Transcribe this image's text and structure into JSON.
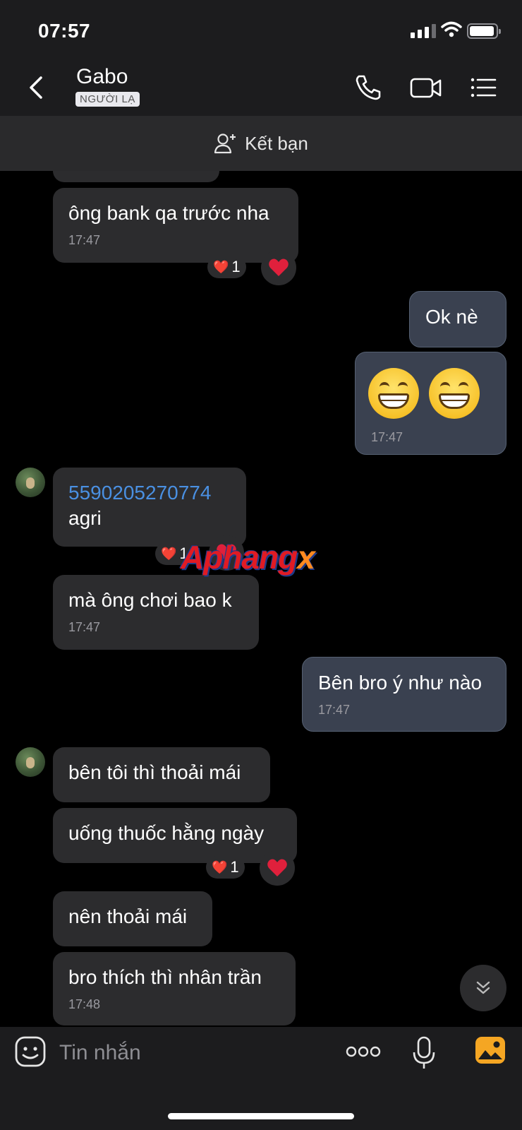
{
  "status_bar": {
    "time": "07:57"
  },
  "header": {
    "name": "Gabo",
    "badge": "NGƯỜI LẠ"
  },
  "add_friend": {
    "label": "Kết bạn"
  },
  "messages": [
    {
      "dir": "in",
      "text": "ông bank qa trước nha",
      "time": "17:47",
      "reaction": "❤️",
      "reaction_count": "1"
    },
    {
      "dir": "out",
      "text": "Ok nè"
    },
    {
      "dir": "out",
      "emoji": [
        "grinning-face",
        "grinning-face"
      ],
      "time": "17:47"
    },
    {
      "dir": "in",
      "link": "5590205270774",
      "text": "agri",
      "reaction": "❤️",
      "reaction_count": "1"
    },
    {
      "dir": "in",
      "text": "mà ông chơi bao k",
      "time": "17:47"
    },
    {
      "dir": "out",
      "text": "Bên bro ý như nào",
      "time": "17:47"
    },
    {
      "dir": "in",
      "text": "bên tôi thì thoải mái"
    },
    {
      "dir": "in",
      "text": "uống thuốc hằng ngày",
      "reaction": "❤️",
      "reaction_count": "1"
    },
    {
      "dir": "in",
      "text": "nên thoải mái"
    },
    {
      "dir": "in",
      "text": "bro thích thì nhân trần",
      "time": "17:48"
    }
  ],
  "watermark": {
    "main": "Aphang",
    "suffix": "x"
  },
  "composer": {
    "placeholder": "Tin nhắn"
  },
  "colors": {
    "accent_link": "#4a90e2",
    "bubble_in": "#2c2c2e",
    "bubble_out": "#3a4150",
    "heart": "#e0203c"
  }
}
